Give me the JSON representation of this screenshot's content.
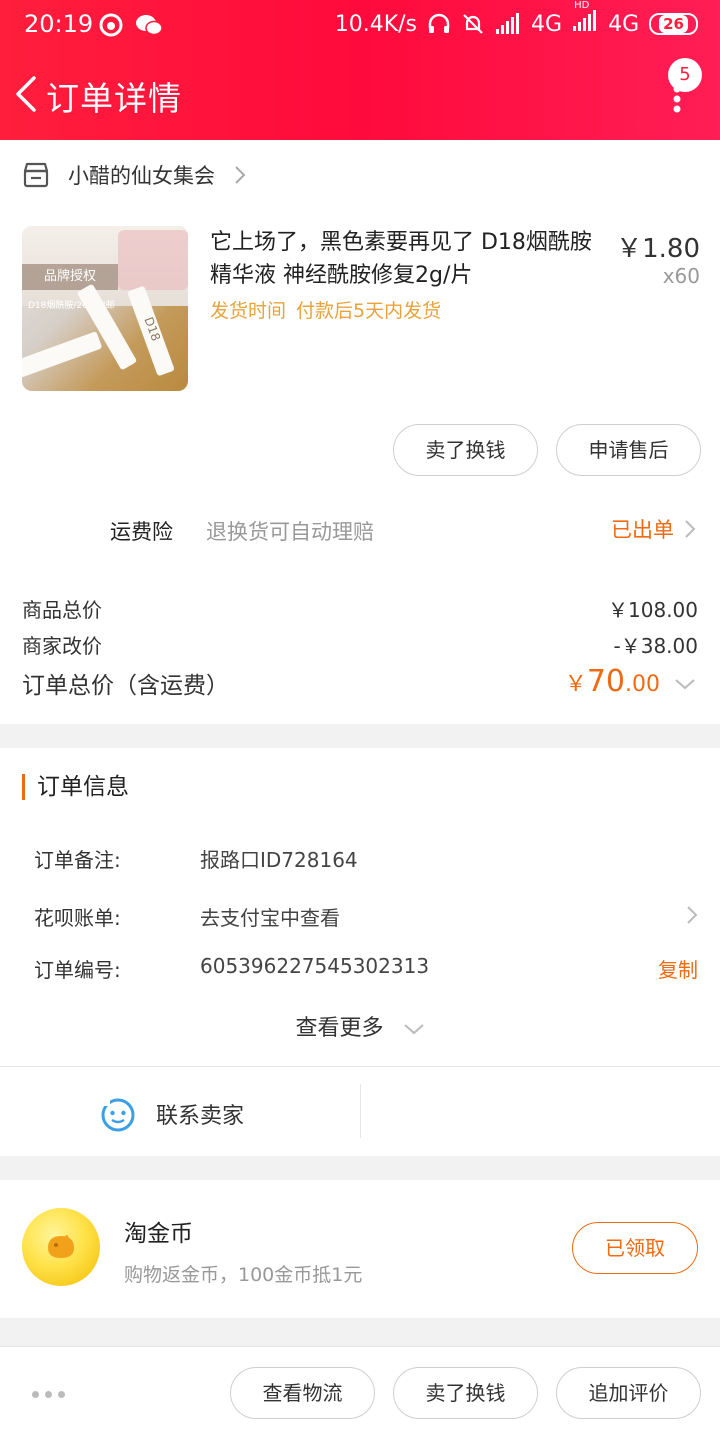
{
  "status_bar": {
    "time": "20:19",
    "net_speed": "10.4K/s",
    "signal1": "4G",
    "hd": "HD",
    "signal2": "4G",
    "battery": "26"
  },
  "header": {
    "title": "订单详情",
    "badge_count": "5"
  },
  "shop": {
    "name": "小醋的仙女集会"
  },
  "product": {
    "title": "它上场了，黑色素要再见了  D18烟酰胺精华液 神经酰胺修复2g/片",
    "ship_label": "发货时间",
    "ship_value": "付款后5天内发货",
    "price": "￥1.80",
    "qty": "x60",
    "thumb_text_1": "品牌授权",
    "thumb_text_2": "D18烟酰胺/20片包邮",
    "thumb_text_3": "D18"
  },
  "product_actions": {
    "sell_label": "卖了换钱",
    "after_sale_label": "申请售后"
  },
  "insurance": {
    "label": "运费险",
    "desc": "退换货可自动理赔",
    "status": "已出单"
  },
  "price_summary": {
    "goods_total_label": "商品总价",
    "goods_total_value": "￥108.00",
    "discount_label": "商家改价",
    "discount_value": "-￥38.00",
    "order_total_label": "订单总价（含运费）",
    "order_total_currency": "￥",
    "order_total_int": "70",
    "order_total_dec": ".00"
  },
  "order_info": {
    "title": "订单信息",
    "remark_label": "订单备注:",
    "remark_value": "报路口ID728164",
    "huabei_label": "花呗账单:",
    "huabei_value": "去支付宝中查看",
    "order_no_label": "订单编号:",
    "order_no_value": "605396227545302313",
    "copy_label": "复制",
    "see_more_label": "查看更多",
    "contact_label": "联系卖家"
  },
  "coin": {
    "title": "淘金币",
    "subtitle": "购物返金币，100金币抵1元",
    "button_label": "已领取"
  },
  "bottom_bar": {
    "logistics_label": "查看物流",
    "sell_label": "卖了换钱",
    "review_label": "追加评价"
  },
  "colors": {
    "brand_red": "#ff0a3c",
    "accent_orange": "#f06a12",
    "ship_yellow": "#e8a33d",
    "contact_blue": "#3aa0e6"
  }
}
